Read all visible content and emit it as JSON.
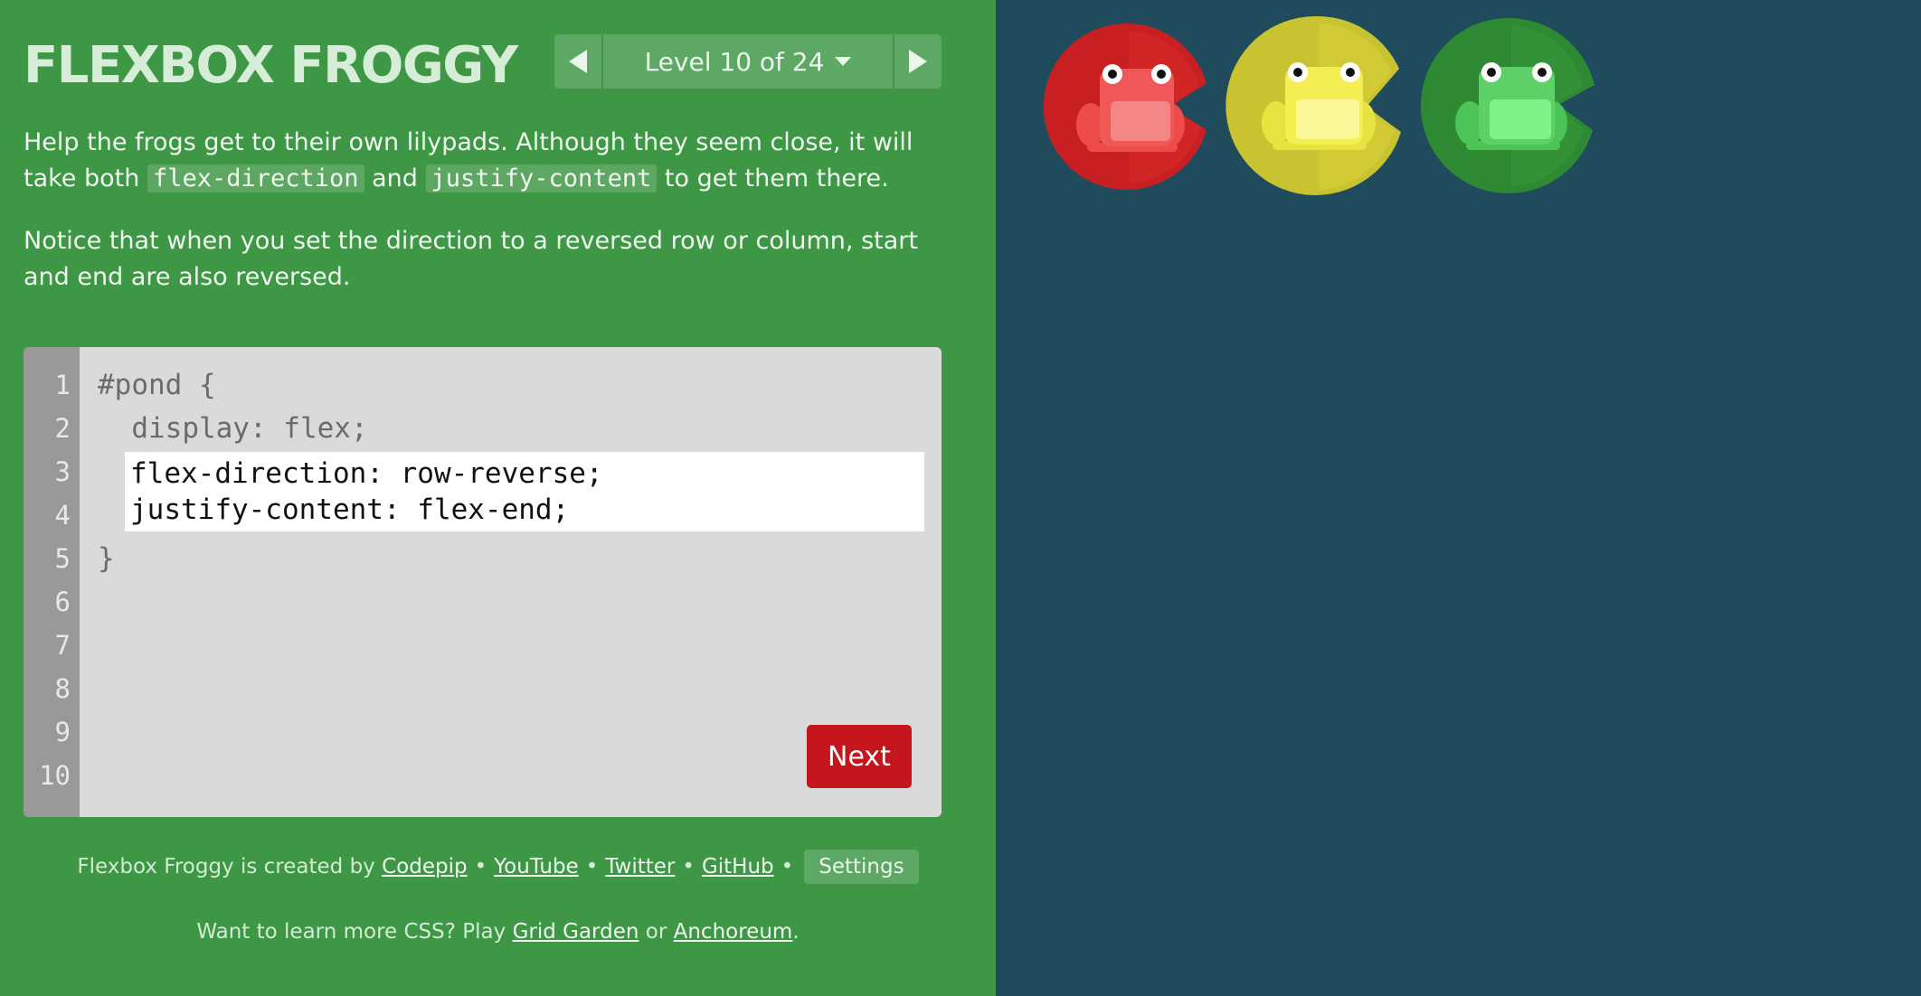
{
  "header": {
    "title": "FLEXBOX FROGGY",
    "level_label": "Level 10 of 24"
  },
  "instructions": {
    "p1_before": "Help the frogs get to their own lilypads. Although they seem close, it will take both ",
    "p1_code1": "flex-direction",
    "p1_mid": " and ",
    "p1_code2": "justify-content",
    "p1_after": " to get them there.",
    "p2": "Notice that when you set the direction to a reversed row or column, start and end are also reversed."
  },
  "editor": {
    "line_numbers": [
      "1",
      "2",
      "3",
      "4",
      "5",
      "6",
      "7",
      "8",
      "9",
      "10"
    ],
    "line1": "#pond {",
    "line2": "  display: flex;",
    "answer": "flex-direction: row-reverse;\njustify-content: flex-end;",
    "line5": "}",
    "next_label": "Next"
  },
  "footer": {
    "credit_text": "Flexbox Froggy is created by",
    "link_codepip": "Codepip",
    "link_youtube": "YouTube",
    "link_twitter": "Twitter",
    "link_github": "GitHub",
    "bullet": "•",
    "settings_label": "Settings",
    "learn_text": "Want to learn more CSS? Play",
    "link_grid_garden": "Grid Garden",
    "or_text": "or",
    "link_anchoreum": "Anchoreum",
    "period": "."
  },
  "colors": {
    "sidebar_bg": "#3e9745",
    "pond_bg": "#1f4b5c",
    "red": "#c81f22",
    "yellow": "#c9c332",
    "green": "#2e8a32",
    "next_button": "#c5161d"
  }
}
